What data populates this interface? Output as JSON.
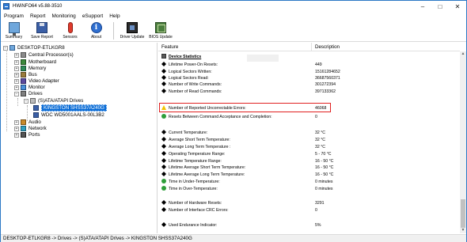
{
  "window": {
    "title": "HWiNFO64 v5.88-3510"
  },
  "menu": [
    "Program",
    "Report",
    "Monitoring",
    "eSupport",
    "Help"
  ],
  "toolbar": {
    "buttons": [
      {
        "label": "Summary",
        "icon": "monitor-icon"
      },
      {
        "label": "Save Report",
        "icon": "disk-icon"
      },
      {
        "label": "Sensors",
        "icon": "thermometer-icon"
      },
      {
        "label": "About",
        "icon": "info-icon"
      },
      {
        "label": "Driver Update",
        "icon": "chip-icon"
      },
      {
        "label": "BIOS Update",
        "icon": "bios-icon"
      }
    ]
  },
  "tree": {
    "root": "DESKTOP-ETLKGR8",
    "items": [
      "Central Processor(s)",
      "Motherboard",
      "Memory",
      "Bus",
      "Video Adapter",
      "Monitor",
      "Drives",
      "(S)ATA/ATAPI Drives",
      "KINGSTON SHSS37A240G",
      "WDC WD5001AALS-00L3B2",
      "Audio",
      "Network",
      "Ports"
    ]
  },
  "table": {
    "col_feature": "Feature",
    "col_description": "Description",
    "rows": [
      {
        "kind": "section",
        "feature": "Device Statistics",
        "value": ""
      },
      {
        "kind": "black",
        "feature": "Lifetime Power-On Resets:",
        "value": "449"
      },
      {
        "kind": "black",
        "feature": "Logical Sectors Written:",
        "value": "15161284652"
      },
      {
        "kind": "black",
        "feature": "Logical Sectors Read:",
        "value": "36687560371"
      },
      {
        "kind": "black",
        "feature": "Number of Write Commands:",
        "value": "301272394"
      },
      {
        "kind": "black",
        "feature": "Number of Read Commands:",
        "value": "397133362"
      },
      {
        "kind": "warn",
        "feature": "Number of Reported Uncorrectable Errors:",
        "value": "46068"
      },
      {
        "kind": "green",
        "feature": "Resets Between Command Acceptance and Completion:",
        "value": "0"
      },
      {
        "kind": "black",
        "feature": "Current Temperature:",
        "value": "32 °C"
      },
      {
        "kind": "black",
        "feature": "Average Short Term Temperature:",
        "value": "32 °C"
      },
      {
        "kind": "black",
        "feature": "Average Long Term Temperature :",
        "value": "32 °C"
      },
      {
        "kind": "black",
        "feature": "Operating Temperature Range:",
        "value": "5 - 70 °C"
      },
      {
        "kind": "black",
        "feature": "Lifetime Temperature Range:",
        "value": "16 - 50 °C"
      },
      {
        "kind": "black",
        "feature": "Lifetime Average Short Term Temperature:",
        "value": "16 - 50 °C"
      },
      {
        "kind": "black",
        "feature": "Lifetime Average Long Term Temperature:",
        "value": "16 - 50 °C"
      },
      {
        "kind": "green",
        "feature": "Time in Under-Temperature:",
        "value": "0 minutes"
      },
      {
        "kind": "green",
        "feature": "Time in Over-Temperature:",
        "value": "0 minutes"
      },
      {
        "kind": "black",
        "feature": "Number of Hardware Resets:",
        "value": "3291"
      },
      {
        "kind": "black",
        "feature": "Number of Interface CRC Errors:",
        "value": "0"
      },
      {
        "kind": "black",
        "feature": "Used Endurance Indicator:",
        "value": "5%"
      }
    ]
  },
  "statusbar": {
    "path": "DESKTOP-ETLKGR8 -> Drives -> (S)ATA/ATAPI Drives -> KINGSTON SHSS37A240G"
  },
  "colors": {
    "selection": "#0a6cd6",
    "highlight_border": "#e02020",
    "warning": "#f2c200",
    "ok": "#2e9e3a"
  }
}
